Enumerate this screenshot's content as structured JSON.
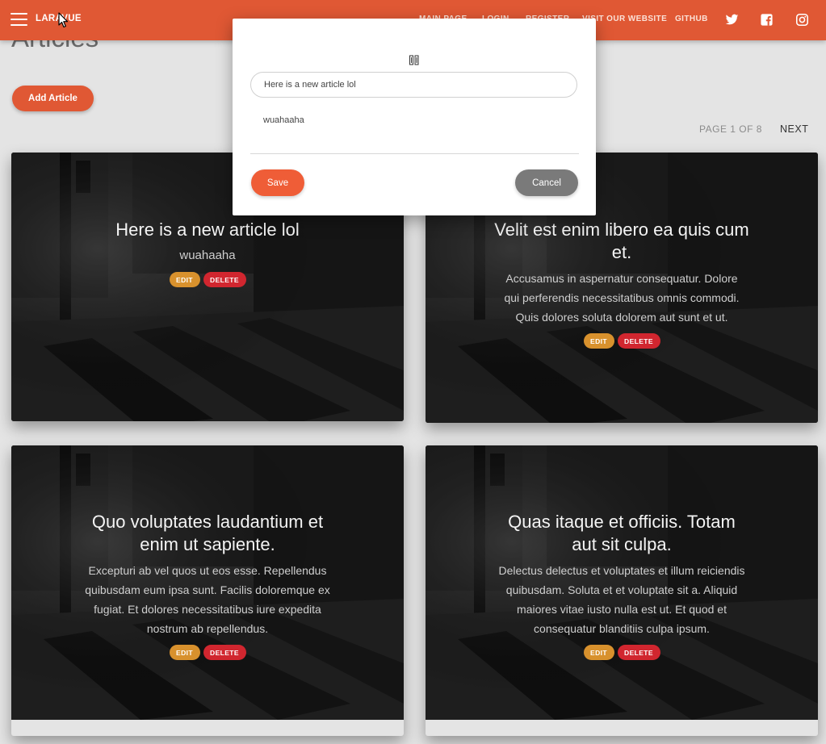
{
  "navbar": {
    "brand": "LARAVUE",
    "links": [
      "MAIN PAGE",
      "LOGIN",
      "REGISTER",
      "VISIT OUR WEBSITE",
      "GITHUB"
    ],
    "icons": [
      "twitter-icon",
      "facebook-icon",
      "instagram-icon"
    ],
    "color": "#e05834"
  },
  "page": {
    "title": "Articles",
    "add_button": "Add Article",
    "pagination": {
      "info": "PAGE 1 OF 8",
      "next": "NEXT"
    }
  },
  "articles": [
    {
      "title": "Here is a new article lol",
      "body": "wuahaaha",
      "edit": "EDIT",
      "delete": "DELETE"
    },
    {
      "title": "Velit est enim libero ea quis cum et.",
      "body": "Accusamus in aspernatur consequatur. Dolore qui perferendis necessitatibus omnis commodi. Quis dolores soluta dolorem aut sunt et ut.",
      "edit": "EDIT",
      "delete": "DELETE"
    },
    {
      "title": "Quo voluptates laudantium et enim ut sapiente.",
      "body": "Excepturi ab vel quos ut eos esse. Repellendus quibusdam eum ipsa sunt. Facilis doloremque ex fugiat. Et dolores necessitatibus iure expedita nostrum ab repellendus.",
      "edit": "EDIT",
      "delete": "DELETE"
    },
    {
      "title": "Quas itaque et officiis. Totam aut sit culpa.",
      "body": "Delectus delectus et voluptates et illum reiciendis quibusdam. Soluta et et voluptate sit a. Aliquid maiores vitae iusto nulla est ut. Et quod et consequatur blanditiis culpa ipsum.",
      "edit": "EDIT",
      "delete": "DELETE"
    }
  ],
  "modal": {
    "title_value": "Here is a new article lol",
    "body_value": "wuahaaha",
    "save": "Save",
    "cancel": "Cancel"
  },
  "colors": {
    "edit": "#d8912d",
    "delete": "#d1262f",
    "save": "#ef5d37",
    "cancel": "#7a7a7a"
  }
}
